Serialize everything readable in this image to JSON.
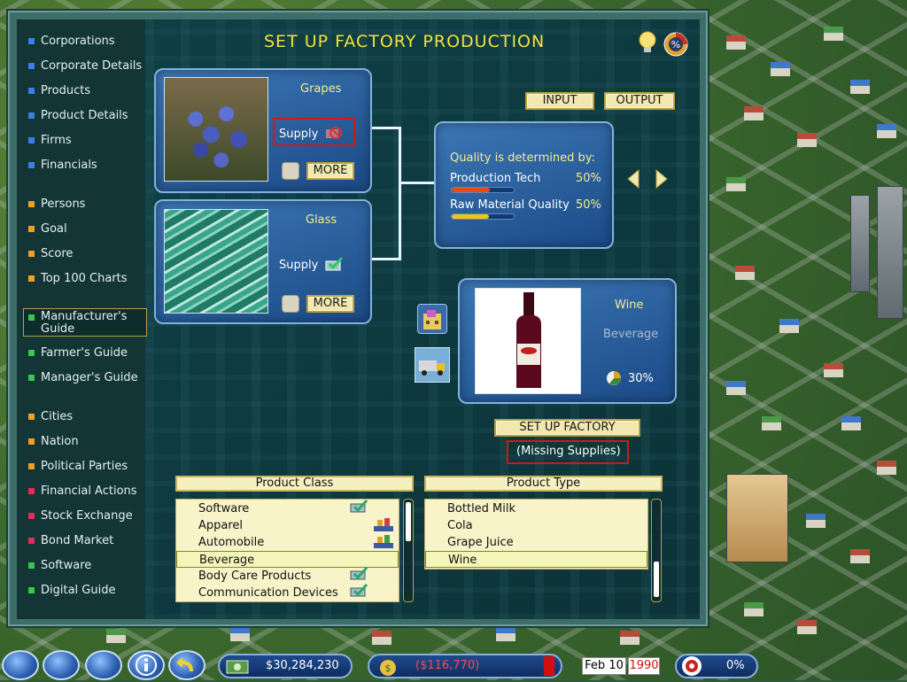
{
  "title": "SET UP FACTORY PRODUCTION",
  "sidebar": {
    "items": [
      {
        "label": "Corporations",
        "color": "#3a7ee8"
      },
      {
        "label": "Corporate Details",
        "color": "#3a7ee8"
      },
      {
        "label": "Products",
        "color": "#3a7ee8"
      },
      {
        "label": "Product Details",
        "color": "#3a7ee8"
      },
      {
        "label": "Firms",
        "color": "#3a7ee8"
      },
      {
        "label": "Financials",
        "color": "#3a7ee8"
      },
      {
        "label": "Persons",
        "color": "#f0a020"
      },
      {
        "label": "Goal",
        "color": "#f0a020"
      },
      {
        "label": "Score",
        "color": "#f0a020"
      },
      {
        "label": "Top 100 Charts",
        "color": "#f0a020"
      },
      {
        "label": "Manufacturer's Guide",
        "color": "#36c84a",
        "selected": true
      },
      {
        "label": "Farmer's Guide",
        "color": "#36c84a"
      },
      {
        "label": "Manager's Guide",
        "color": "#36c84a"
      },
      {
        "label": "Cities",
        "color": "#f0a020"
      },
      {
        "label": "Nation",
        "color": "#f0a020"
      },
      {
        "label": "Political Parties",
        "color": "#f0a020"
      },
      {
        "label": "Financial Actions",
        "color": "#e8285a"
      },
      {
        "label": "Stock Exchange",
        "color": "#e8285a"
      },
      {
        "label": "Bond Market",
        "color": "#e8285a"
      },
      {
        "label": "Software",
        "color": "#36c84a"
      },
      {
        "label": "Digital Guide",
        "color": "#36c84a"
      }
    ]
  },
  "inputs": [
    {
      "name": "Grapes",
      "supply_label": "Supply",
      "more_label": "MORE",
      "supply_icon": "unavailable-supply-icon"
    },
    {
      "name": "Glass",
      "supply_label": "Supply",
      "more_label": "MORE",
      "supply_icon": "supply-check-icon"
    }
  ],
  "tabs": {
    "input": "INPUT",
    "output": "OUTPUT"
  },
  "quality": {
    "heading": "Quality is determined by:",
    "factors": [
      {
        "label": "Production Tech",
        "percent": "50%",
        "fill": 0.62,
        "color": "#e84a14"
      },
      {
        "label": "Raw Material Quality",
        "percent": "50%",
        "fill": 0.6,
        "color": "#f2c418"
      }
    ]
  },
  "product": {
    "name": "Wine",
    "category": "Beverage",
    "share": "30%"
  },
  "factory": {
    "button_label": "SET UP FACTORY",
    "status": "(Missing Supplies)"
  },
  "product_class": {
    "header": "Product Class",
    "items": [
      "Software",
      "Apparel",
      "Automobile",
      "Beverage",
      "Body Care Products",
      "Communication Devices"
    ],
    "selected_index": 3
  },
  "product_type": {
    "header": "Product Type",
    "items": [
      "Bottled Milk",
      "Cola",
      "Grape Juice",
      "Wine"
    ],
    "selected_index": 3
  },
  "status_bar": {
    "cash": "$30,284,230",
    "profit": "($116,770)",
    "date_month": "Feb",
    "date_day": "10",
    "date_year": "1990",
    "percent": "0%"
  }
}
